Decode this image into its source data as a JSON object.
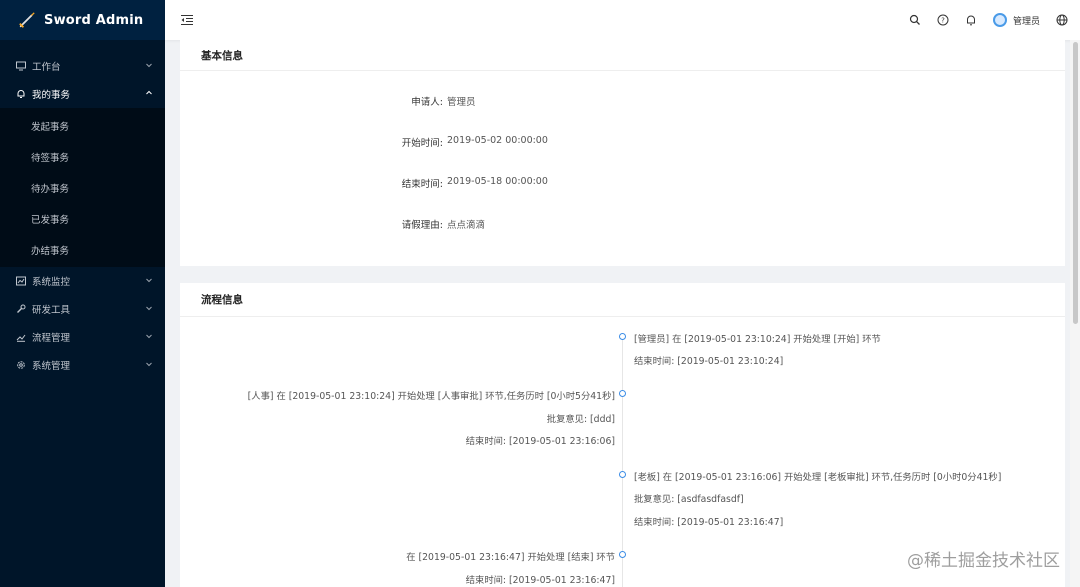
{
  "app": {
    "title": "Sword Admin"
  },
  "sidebar": {
    "items": [
      {
        "label": "工作台",
        "icon": "monitor-icon",
        "expanded": false
      },
      {
        "label": "我的事务",
        "icon": "bell-icon",
        "expanded": true,
        "children": [
          "发起事务",
          "待签事务",
          "待办事务",
          "已发事务",
          "办结事务"
        ]
      },
      {
        "label": "系统监控",
        "icon": "chart-icon",
        "expanded": false
      },
      {
        "label": "研发工具",
        "icon": "tool-icon",
        "expanded": false
      },
      {
        "label": "流程管理",
        "icon": "flow-icon",
        "expanded": false
      },
      {
        "label": "系统管理",
        "icon": "gear-icon",
        "expanded": false
      }
    ]
  },
  "header": {
    "username": "管理员",
    "icons": [
      "search-icon",
      "help-icon",
      "bell-icon",
      "avatar",
      "globe-icon"
    ]
  },
  "basic_info": {
    "title": "基本信息",
    "fields": [
      {
        "label": "申请人:",
        "value": "管理员"
      },
      {
        "label": "开始时间:",
        "value": "2019-05-02 00:00:00"
      },
      {
        "label": "结束时间:",
        "value": "2019-05-18 00:00:00"
      },
      {
        "label": "请假理由:",
        "value": "点点滴滴"
      }
    ]
  },
  "process_info": {
    "title": "流程信息",
    "timeline": [
      {
        "side": "right",
        "lines": [
          "[管理员] 在 [2019-05-01 23:10:24] 开始处理 [开始] 环节",
          "结束时间: [2019-05-01 23:10:24]"
        ]
      },
      {
        "side": "left",
        "lines": [
          "[人事] 在 [2019-05-01 23:10:24] 开始处理 [人事审批] 环节,任务历时 [0小时5分41秒]",
          "批复意见: [ddd]",
          "结束时间: [2019-05-01 23:16:06]"
        ]
      },
      {
        "side": "right",
        "lines": [
          "[老板] 在 [2019-05-01 23:16:06] 开始处理 [老板审批] 环节,任务历时 [0小时0分41秒]",
          "批复意见: [asdfasdfasdf]",
          "结束时间: [2019-05-01 23:16:47]"
        ]
      },
      {
        "side": "left",
        "lines": [
          "在 [2019-05-01 23:16:47] 开始处理 [结束] 环节",
          "结束时间: [2019-05-01 23:16:47]"
        ]
      }
    ]
  },
  "watermark": "@稀土掘金技术社区",
  "colors": {
    "sidebar_bg": "#001529",
    "submenu_bg": "#000c17",
    "accent": "#3c8de6"
  }
}
